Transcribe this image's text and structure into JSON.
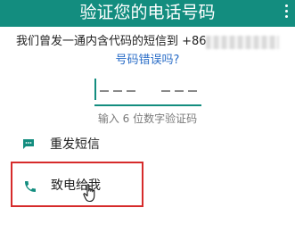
{
  "header": {
    "title": "验证您的电话号码",
    "menu_icon": "more-vert-icon"
  },
  "verification": {
    "instruction": "我们曾发一通内含代码的短信到 +86",
    "wrong_number_link": "号码错误吗?",
    "code_hint": "输入 6 位数字验证码"
  },
  "options": {
    "resend_sms": {
      "label": "重发短信",
      "icon": "sms-icon"
    },
    "call_me": {
      "label": "致电给我",
      "icon": "phone-icon"
    }
  },
  "colors": {
    "accent": "#138d7f",
    "link": "#2a6dc7",
    "highlight_border": "#d62b2b"
  }
}
